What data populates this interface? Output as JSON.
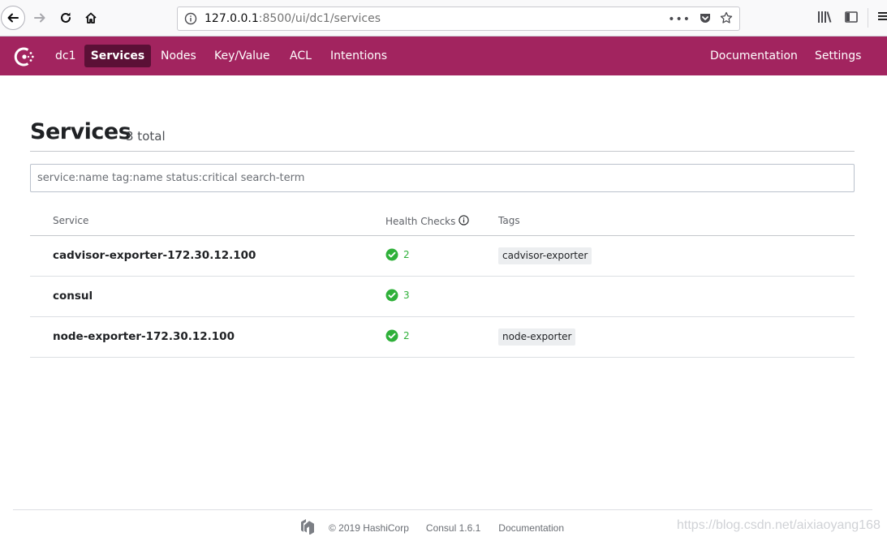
{
  "browser": {
    "url_host": "127.0.0.1",
    "url_rest": ":8500/ui/dc1/services",
    "url_menu": "•••"
  },
  "nav": {
    "datacenter": "dc1",
    "items": [
      {
        "label": "Services",
        "active": true
      },
      {
        "label": "Nodes"
      },
      {
        "label": "Key/Value"
      },
      {
        "label": "ACL"
      },
      {
        "label": "Intentions"
      }
    ],
    "right": [
      {
        "label": "Documentation"
      },
      {
        "label": "Settings"
      }
    ],
    "colors": {
      "bar": "#a2245f",
      "active": "#5b1036"
    }
  },
  "page": {
    "title": "Services",
    "count": "3 total",
    "search_placeholder": "service:name tag:name status:critical search-term"
  },
  "table": {
    "headers": {
      "service": "Service",
      "health": "Health Checks",
      "tags": "Tags"
    },
    "rows": [
      {
        "name": "cadvisor-exporter-172.30.12.100",
        "health_count": "2",
        "health_status": "passing",
        "tag": "cadvisor-exporter"
      },
      {
        "name": "consul",
        "health_count": "3",
        "health_status": "passing",
        "tag": ""
      },
      {
        "name": "node-exporter-172.30.12.100",
        "health_count": "2",
        "health_status": "passing",
        "tag": "node-exporter"
      }
    ],
    "colors": {
      "passing": "#2eb039"
    }
  },
  "footer": {
    "copyright": "© 2019 HashiCorp",
    "version": "Consul 1.6.1",
    "docs": "Documentation",
    "watermark": "https://blog.csdn.net/aixiaoyang168"
  }
}
